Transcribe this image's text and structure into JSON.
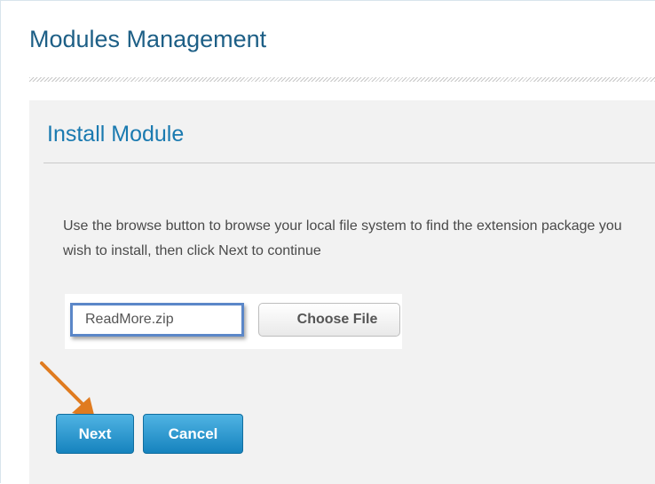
{
  "page": {
    "title": "Modules Management"
  },
  "panel": {
    "title": "Install Module",
    "instructions": "Use the browse button to browse your local file system to find the extension package you wish to install, then click Next to continue"
  },
  "file_input": {
    "selected_file": "ReadMore.zip",
    "choose_label": "Choose File"
  },
  "actions": {
    "next_label": "Next",
    "cancel_label": "Cancel"
  },
  "colors": {
    "title": "#1d5f86",
    "panel_title": "#1a7ab0",
    "button": "#1683be",
    "highlight_box": "#5b87c8",
    "arrow": "#e07b1f"
  },
  "icons": {
    "annotation": "arrow-icon"
  }
}
